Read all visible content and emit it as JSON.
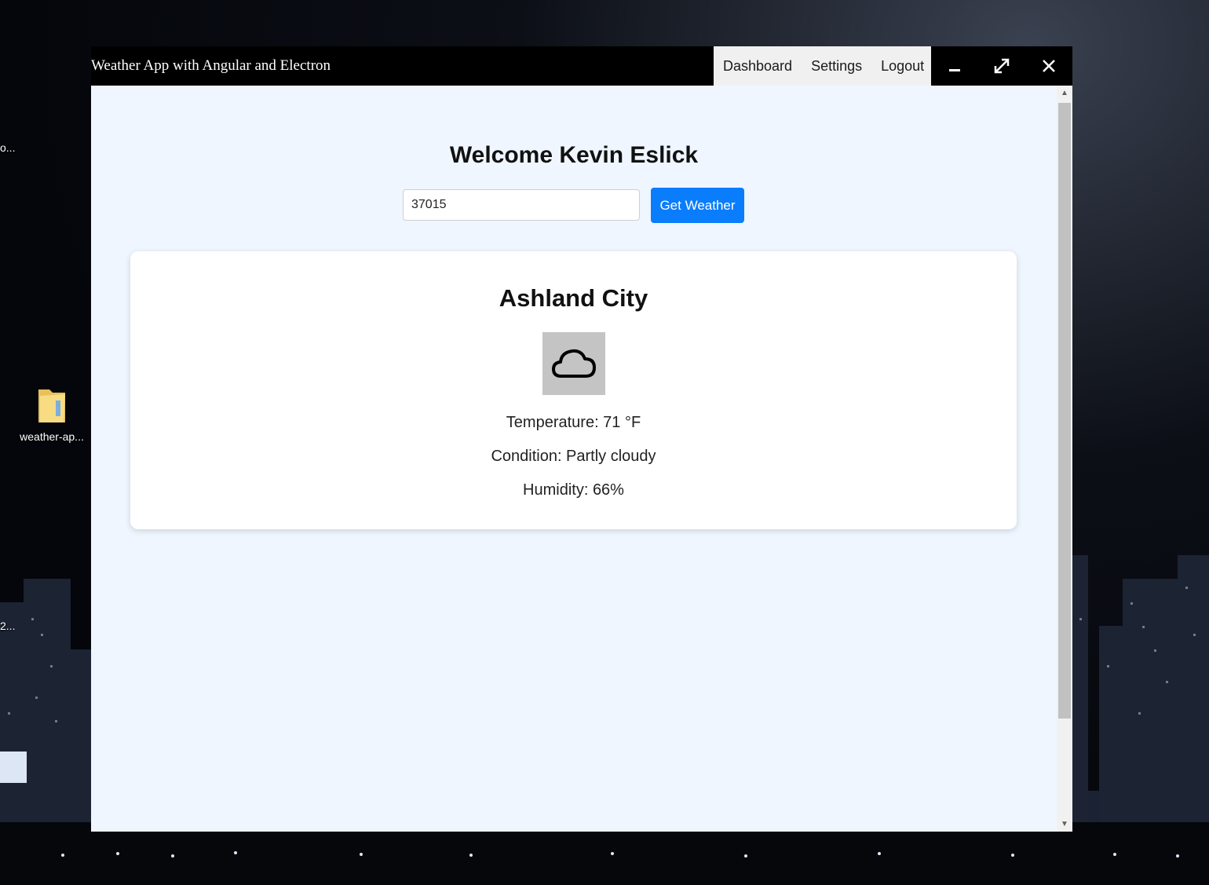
{
  "window": {
    "title": "Weather App with Angular and Electron",
    "menu": [
      {
        "label": "Dashboard"
      },
      {
        "label": "Settings"
      },
      {
        "label": "Logout"
      }
    ]
  },
  "main": {
    "welcome": "Welcome Kevin Eslick",
    "zip_value": "37015",
    "button_label": "Get Weather"
  },
  "weather": {
    "city": "Ashland City",
    "icon": "cloud-icon",
    "temperature": "Temperature: 71 °F",
    "condition": "Condition: Partly cloudy",
    "humidity": "Humidity: 66%"
  },
  "desktop": {
    "folder_label": "weather-ap...",
    "fragment_top": "o...",
    "fragment_bottom": "2..."
  },
  "colors": {
    "accent": "#0a7dfc",
    "page_bg": "#eff6ff",
    "titlebar": "#000000"
  }
}
